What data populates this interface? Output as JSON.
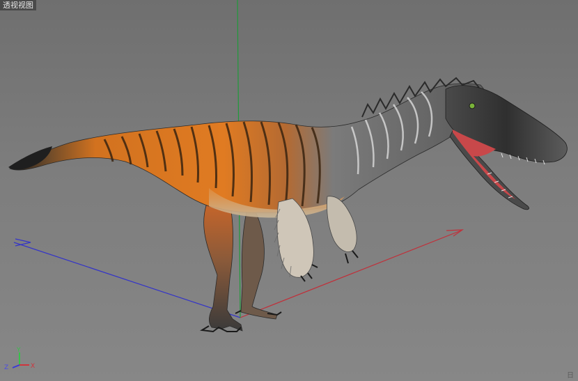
{
  "viewport": {
    "label": "透视视图",
    "corner_text": "日"
  },
  "axis_gizmo": {
    "y_label": "Y",
    "z_label": "Z",
    "x_label": "X"
  },
  "colors": {
    "background": "#7a7a7a",
    "x_axis": "#c0303a",
    "y_axis": "#1f9a3a",
    "z_axis": "#3a3ad0",
    "dino_orange": "#d9701e",
    "dino_stripes": "#3a2410",
    "dino_head": "#3a3a3a",
    "mouth": "#c8484a"
  }
}
